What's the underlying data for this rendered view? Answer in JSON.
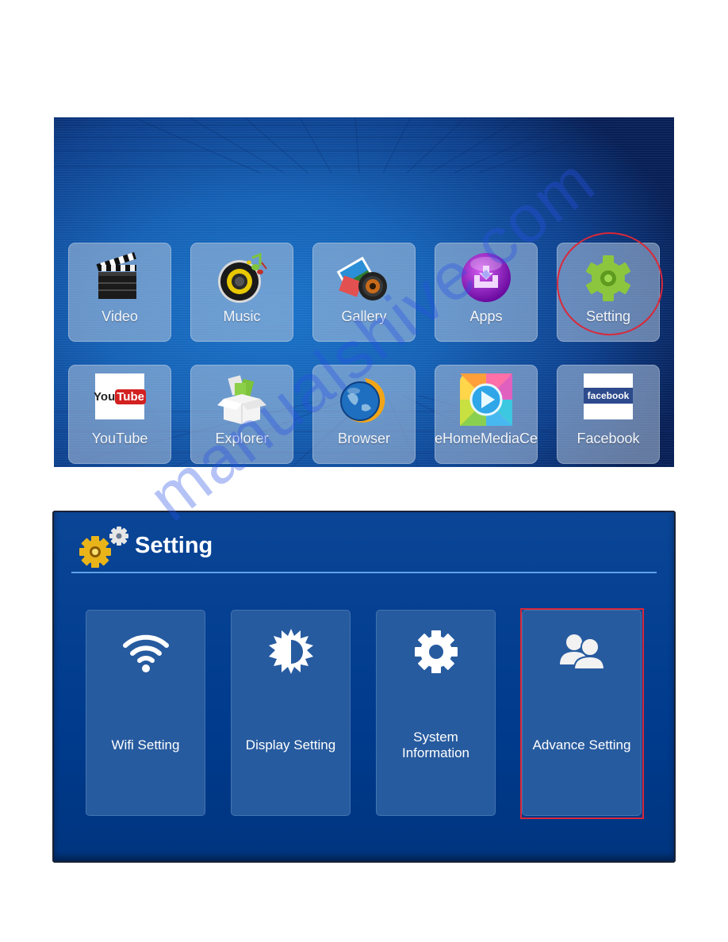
{
  "home": {
    "apps_row1": [
      {
        "label": "Video",
        "icon": "clapperboard-icon"
      },
      {
        "label": "Music",
        "icon": "speaker-music-icon"
      },
      {
        "label": "Gallery",
        "icon": "gallery-camera-icon"
      },
      {
        "label": "Apps",
        "icon": "apps-download-icon"
      },
      {
        "label": "Setting",
        "icon": "green-gear-icon"
      }
    ],
    "apps_row2": [
      {
        "label": "YouTube",
        "icon": "youtube-icon",
        "logo_you": "You",
        "logo_tube": "Tube"
      },
      {
        "label": "Explorer",
        "icon": "explorer-box-icon"
      },
      {
        "label": "Browser",
        "icon": "globe-browser-icon"
      },
      {
        "label": "eHomeMediaCe",
        "icon": "media-center-play-icon"
      },
      {
        "label": "Facebook",
        "icon": "facebook-icon",
        "logo": "facebook"
      }
    ],
    "highlighted_app": "Setting"
  },
  "settings": {
    "title": "Setting",
    "cards": [
      {
        "label": "Wifi Setting",
        "icon": "wifi-icon"
      },
      {
        "label": "Display Setting",
        "icon": "brightness-icon"
      },
      {
        "label_line1": "System",
        "label_line2": "Information",
        "icon": "gear-icon"
      },
      {
        "label": "Advance Setting",
        "icon": "users-icon"
      }
    ],
    "highlighted_card": "Advance Setting"
  },
  "watermark": "manualshive.com",
  "colors": {
    "highlight": "#d9283a",
    "settings_bg": "#003b8e",
    "card_bg": "#275b9f",
    "divider": "#5fa2e6"
  }
}
